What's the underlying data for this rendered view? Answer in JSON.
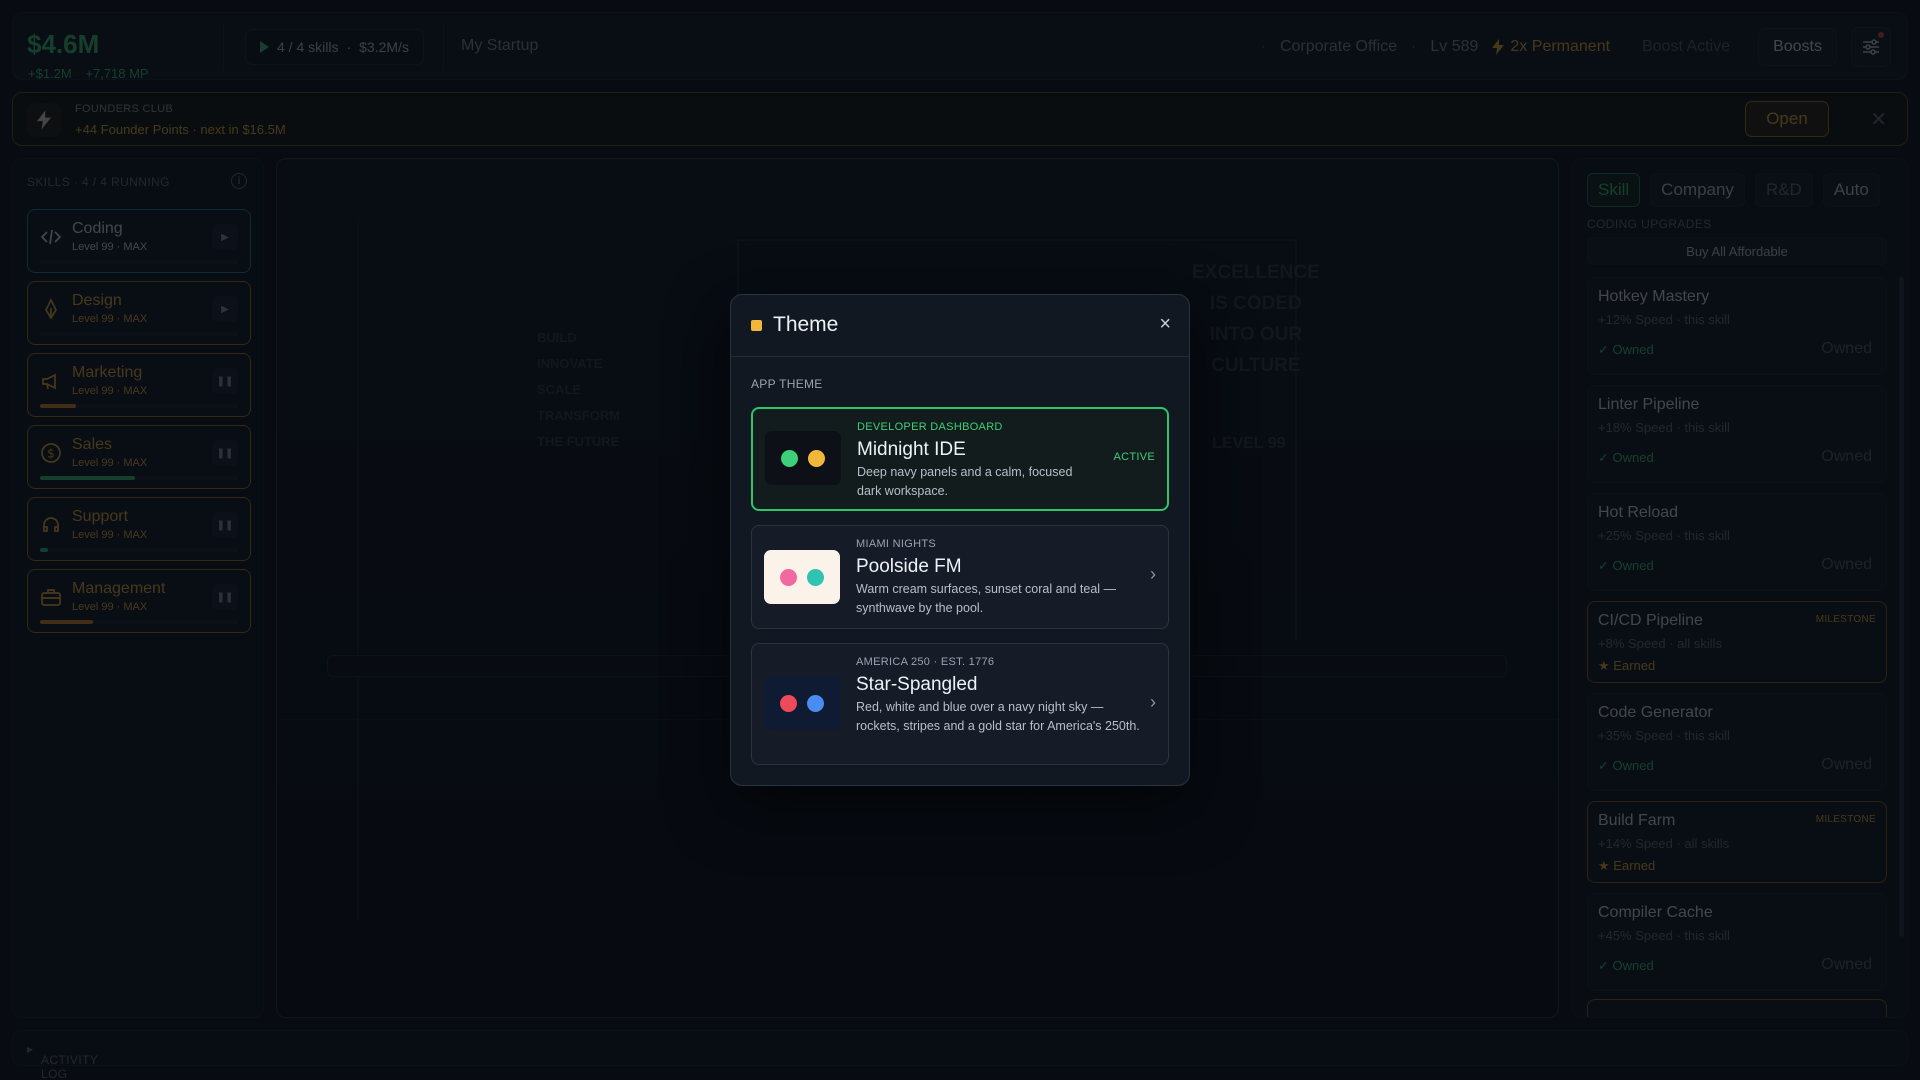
{
  "topbar": {
    "money": "$4.6M",
    "money_delta": "+$1.2M",
    "mp_delta": "+7,718 MP",
    "running": "4 / 4 skills",
    "rate": "$3.2M/s",
    "startup_name": "My Startup",
    "location": "Corporate Office",
    "level": "Lv 589",
    "multiplier": "2x Permanent",
    "boost_status": "Boost Active",
    "boosts_label": "Boosts"
  },
  "founders": {
    "title": "FOUNDERS CLUB",
    "points": "+44 Founder Points",
    "next": "next in $16.5M",
    "open_label": "Open"
  },
  "skills_panel": {
    "header": "SKILLS",
    "running": "4 / 4 RUNNING",
    "items": [
      {
        "name": "Coding",
        "level": "Level 99",
        "max": "MAX",
        "progress": 0,
        "accent": "#1d8a99"
      },
      {
        "name": "Design",
        "level": "Level 99",
        "max": "MAX",
        "progress": 0,
        "accent": "#a67c20"
      },
      {
        "name": "Marketing",
        "level": "Level 99",
        "max": "MAX",
        "progress": 0.18,
        "accent": "#a67c20"
      },
      {
        "name": "Sales",
        "level": "Level 99",
        "max": "MAX",
        "progress": 0.48,
        "accent": "#a67c20"
      },
      {
        "name": "Support",
        "level": "Level 99",
        "max": "MAX",
        "progress": 0.04,
        "accent": "#a67c20"
      },
      {
        "name": "Management",
        "level": "Level 99",
        "max": "MAX",
        "progress": 0.27,
        "accent": "#a67c20"
      }
    ]
  },
  "scene": {
    "slogan_lines": [
      "BUILD",
      "INNOVATE",
      "SCALE",
      "TRANSFORM",
      "THE FUTURE"
    ],
    "poster_lines": [
      "EXCELLENCE",
      "IS CODED",
      "INTO OUR",
      "CULTURE"
    ],
    "badge": "LEVEL 99"
  },
  "right_panel": {
    "tabs": [
      "Skill",
      "Company",
      "R&D",
      "Auto"
    ],
    "section": "CODING UPGRADES",
    "buy_all": "Buy All Affordable",
    "upgrades": [
      {
        "name": "Hotkey Mastery",
        "effect": "+12% Speed",
        "scope": "this skill",
        "status": "✓ Owned",
        "right": "Owned",
        "milestone": ""
      },
      {
        "name": "Linter Pipeline",
        "effect": "+18% Speed",
        "scope": "this skill",
        "status": "✓ Owned",
        "right": "Owned",
        "milestone": ""
      },
      {
        "name": "Hot Reload",
        "effect": "+25% Speed",
        "scope": "this skill",
        "status": "✓ Owned",
        "right": "Owned",
        "milestone": ""
      },
      {
        "name": "CI/CD Pipeline",
        "effect": "+8% Speed",
        "scope": "all skills",
        "status": "★ Earned",
        "right": "",
        "milestone": "MILESTONE"
      },
      {
        "name": "Code Generator",
        "effect": "+35% Speed",
        "scope": "this skill",
        "status": "✓ Owned",
        "right": "Owned",
        "milestone": ""
      },
      {
        "name": "Build Farm",
        "effect": "+14% Speed",
        "scope": "all skills",
        "status": "★ Earned",
        "right": "",
        "milestone": "MILESTONE"
      },
      {
        "name": "Compiler Cache",
        "effect": "+45% Speed",
        "scope": "this skill",
        "status": "✓ Owned",
        "right": "Owned",
        "milestone": ""
      }
    ]
  },
  "activity_log": "ACTIVITY LOG",
  "modal": {
    "title": "Theme",
    "close": "×",
    "section": "APP THEME",
    "themes": [
      {
        "eyebrow": "DEVELOPER DASHBOARD",
        "name": "Midnight IDE",
        "desc": "Deep navy panels and a calm, focused dark workspace.",
        "active": "ACTIVE",
        "swatch_bg": "#0d1017",
        "dot1": "#3ecf7a",
        "dot2": "#f0b73a"
      },
      {
        "eyebrow": "MIAMI NIGHTS",
        "name": "Poolside FM",
        "desc": "Warm cream surfaces, sunset coral and teal — synthwave by the pool.",
        "active": "",
        "swatch_bg": "#fbf3ea",
        "dot1": "#f06aa0",
        "dot2": "#2fc4b2"
      },
      {
        "eyebrow": "AMERICA 250 · EST. 1776",
        "name": "Star-Spangled",
        "desc": "Red, white and blue over a navy night sky — rockets, stripes and a gold star for America's 250th.",
        "active": "",
        "swatch_bg": "#0f1a33",
        "dot1": "#ee4b5a",
        "dot2": "#4a8cf0"
      }
    ]
  }
}
